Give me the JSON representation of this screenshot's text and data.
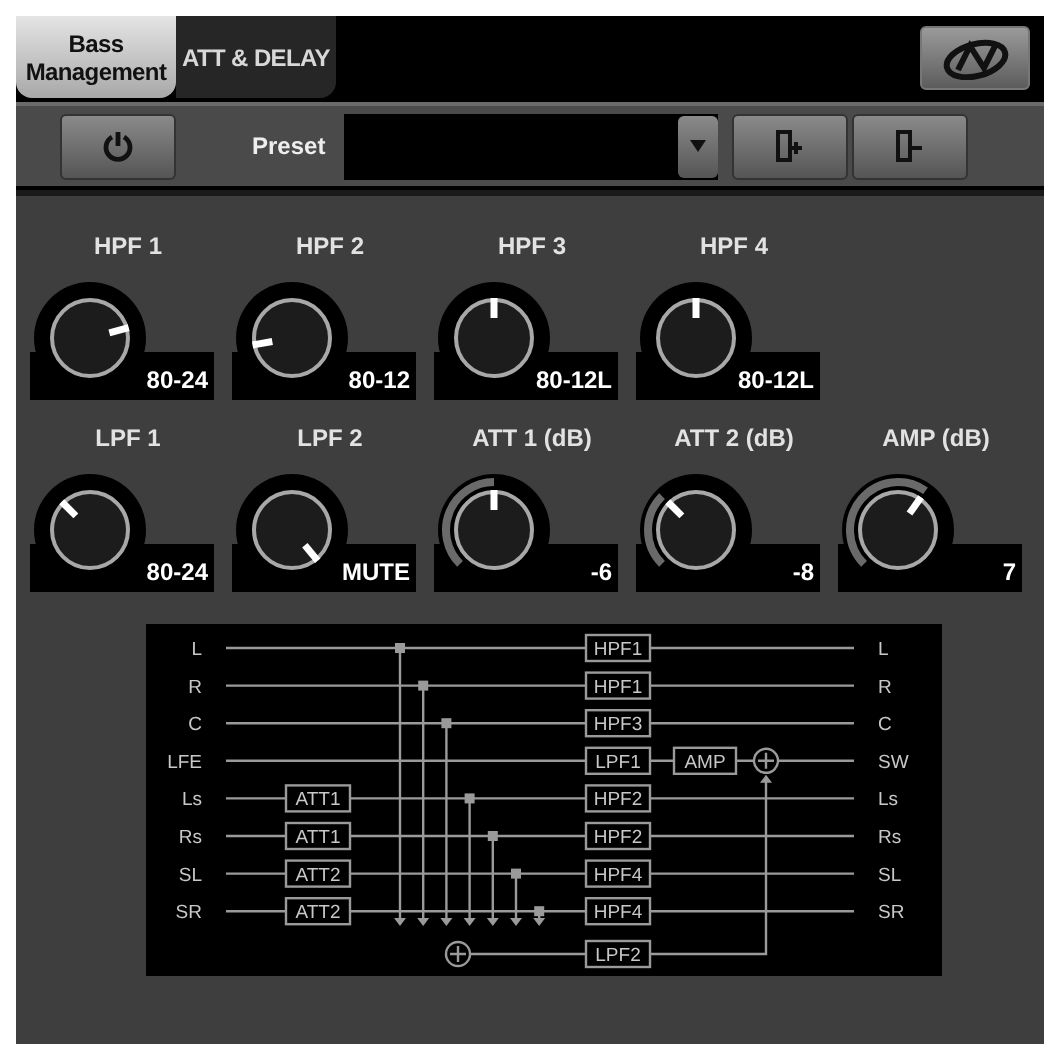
{
  "tabs": [
    {
      "label": "Bass Management",
      "selected": true
    },
    {
      "label": "ATT & DELAY",
      "selected": false
    }
  ],
  "toolbar": {
    "preset_label": "Preset"
  },
  "knob_rows": [
    [
      {
        "label": "HPF 1",
        "value": "80-24",
        "kind": "plain"
      },
      {
        "label": "HPF 2",
        "value": "80-12",
        "kind": "plain"
      },
      {
        "label": "HPF 3",
        "value": "80-12L",
        "kind": "plain"
      },
      {
        "label": "HPF 4",
        "value": "80-12L",
        "kind": "plain"
      }
    ],
    [
      {
        "label": "LPF 1",
        "value": "80-24",
        "kind": "plain"
      },
      {
        "label": "LPF 2",
        "value": "MUTE",
        "kind": "plain"
      },
      {
        "label": "ATT 1 (dB)",
        "value": "-6",
        "kind": "arc"
      },
      {
        "label": "ATT 2 (dB)",
        "value": "-8",
        "kind": "arc"
      },
      {
        "label": "AMP (dB)",
        "value": "7",
        "kind": "arc"
      }
    ]
  ],
  "diagram": {
    "rows": [
      {
        "kind": "main",
        "input": "L",
        "filter": "HPF1",
        "output": "L"
      },
      {
        "kind": "main",
        "input": "R",
        "filter": "HPF1",
        "output": "R"
      },
      {
        "kind": "main",
        "input": "C",
        "filter": "HPF3",
        "output": "C"
      },
      {
        "kind": "sub",
        "input": "LFE",
        "filter": "LPF1",
        "amp": "AMP",
        "output": "SW"
      },
      {
        "kind": "main",
        "input": "Ls",
        "att": "ATT1",
        "filter": "HPF2",
        "output": "Ls"
      },
      {
        "kind": "main",
        "input": "Rs",
        "att": "ATT1",
        "filter": "HPF2",
        "output": "Rs"
      },
      {
        "kind": "main",
        "input": "SL",
        "att": "ATT2",
        "filter": "HPF4",
        "output": "SL"
      },
      {
        "kind": "main",
        "input": "SR",
        "att": "ATT2",
        "filter": "HPF4",
        "output": "SR"
      }
    ],
    "sub_filter": "LPF2"
  }
}
